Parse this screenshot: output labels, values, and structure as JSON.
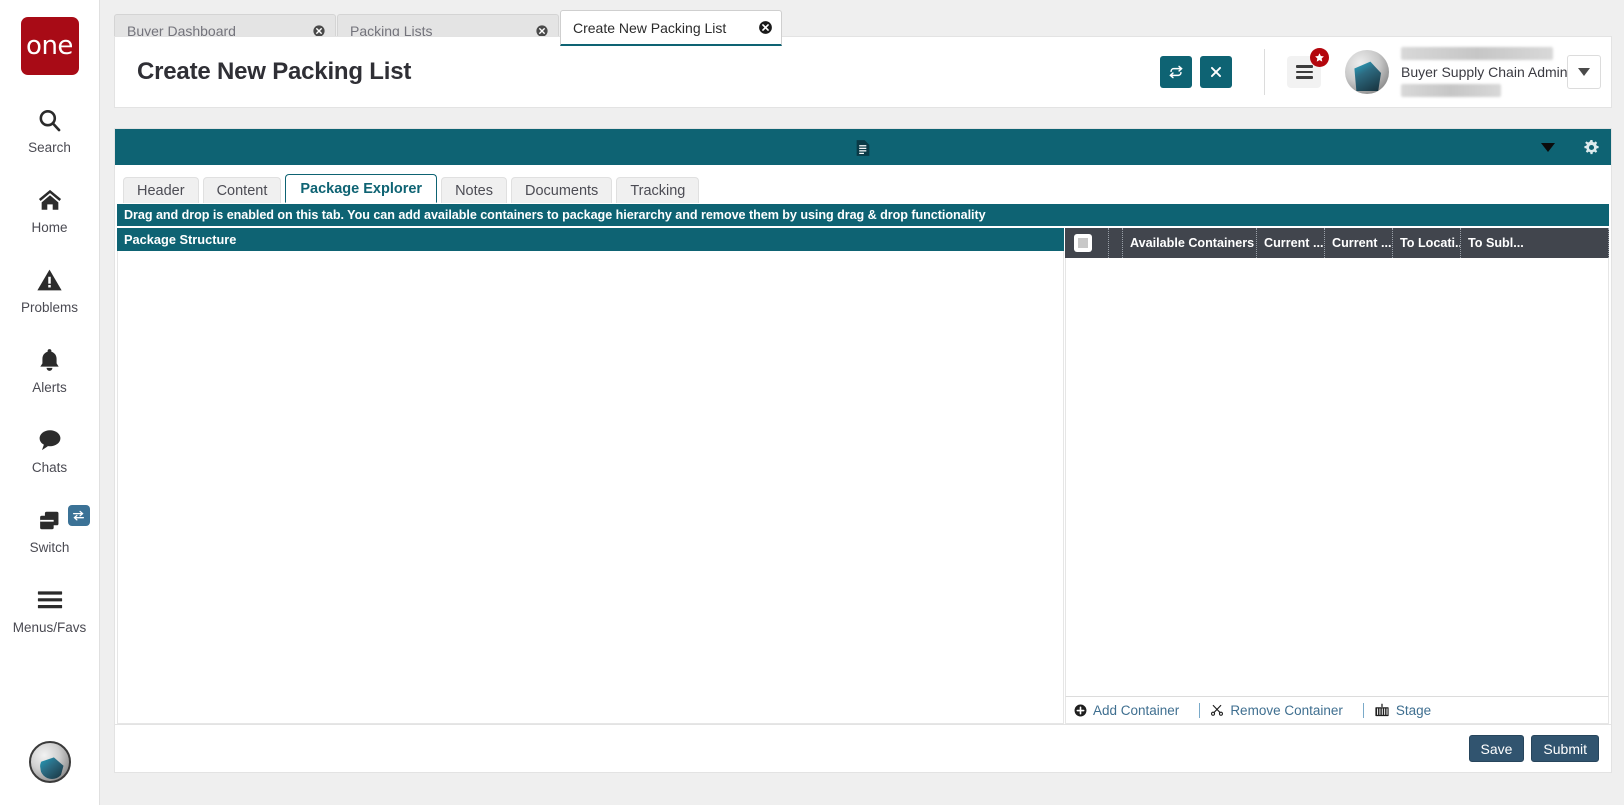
{
  "rail": {
    "logo_text": "one",
    "items": [
      {
        "label": "Search",
        "icon": "search-icon"
      },
      {
        "label": "Home",
        "icon": "home-icon"
      },
      {
        "label": "Problems",
        "icon": "warning-triangle-icon"
      },
      {
        "label": "Alerts",
        "icon": "bell-icon"
      },
      {
        "label": "Chats",
        "icon": "chat-bubble-icon"
      },
      {
        "label": "Switch",
        "icon": "switch-windows-icon",
        "badge_icon": "exchange-arrows-icon"
      },
      {
        "label": "Menus/Favs",
        "icon": "hamburger-icon"
      }
    ]
  },
  "browser_tabs": [
    {
      "label": "Buyer Dashboard",
      "active": false
    },
    {
      "label": "Packing Lists",
      "active": false
    },
    {
      "label": "Create New Packing List",
      "active": true
    }
  ],
  "header": {
    "title": "Create New Packing List",
    "refresh_label": "↻",
    "close_label": "✕",
    "notification_badge": "★",
    "user_role": "Buyer Supply Chain Admin",
    "user_name_redacted": "",
    "user_org_redacted": ""
  },
  "card": {
    "topbar": {
      "doc_icon": "document-icon",
      "caret_icon": "caret-down-icon",
      "gear_icon": "gear-icon"
    },
    "tabs": [
      {
        "label": "Header",
        "active": false
      },
      {
        "label": "Content",
        "active": false
      },
      {
        "label": "Package Explorer",
        "active": true
      },
      {
        "label": "Notes",
        "active": false
      },
      {
        "label": "Documents",
        "active": false
      },
      {
        "label": "Tracking",
        "active": false
      }
    ],
    "notice": "Drag and drop is enabled on this tab. You can add available containers to package hierarchy and remove them by using drag & drop functionality",
    "left_pane": {
      "title": "Package Structure"
    },
    "right_pane": {
      "columns": [
        "Available Containers",
        "Current ...",
        "Current ...",
        "To Locati...",
        "To Subl..."
      ],
      "footer_actions": [
        {
          "label": "Add Container",
          "icon": "plus-circle-icon"
        },
        {
          "label": "Remove Container",
          "icon": "scissors-icon"
        },
        {
          "label": "Stage",
          "icon": "container-icon"
        }
      ]
    },
    "footer_buttons": [
      {
        "label": "Save"
      },
      {
        "label": "Submit"
      }
    ]
  },
  "colors": {
    "teal": "#0e6373",
    "brand_red": "#a80b16",
    "grid_header": "#41454d",
    "button_blue": "#31546f",
    "link_blue": "#3f6f90"
  }
}
